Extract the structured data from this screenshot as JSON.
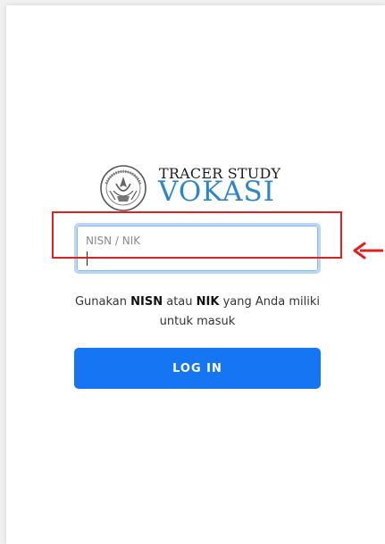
{
  "logo": {
    "line1": "TRACER STUDY",
    "line2": "VOKASI",
    "seal_text": "TUT WURI HANDAYANI",
    "line1_color": "#1c1c1c",
    "line2_color": "#2f86c6"
  },
  "login_form": {
    "identifier_label": "NISN / NIK",
    "identifier_value": "",
    "hint_prefix": "Gunakan ",
    "hint_nisn": "NISN",
    "hint_middle": " atau ",
    "hint_nik": "NIK",
    "hint_suffix": " yang Anda miliki untuk masuk",
    "login_button_label": "LOG IN",
    "button_color": "#1675f2"
  },
  "annotation": {
    "highlight_color": "#e02020",
    "arrow_icon": "arrow-left-icon"
  }
}
